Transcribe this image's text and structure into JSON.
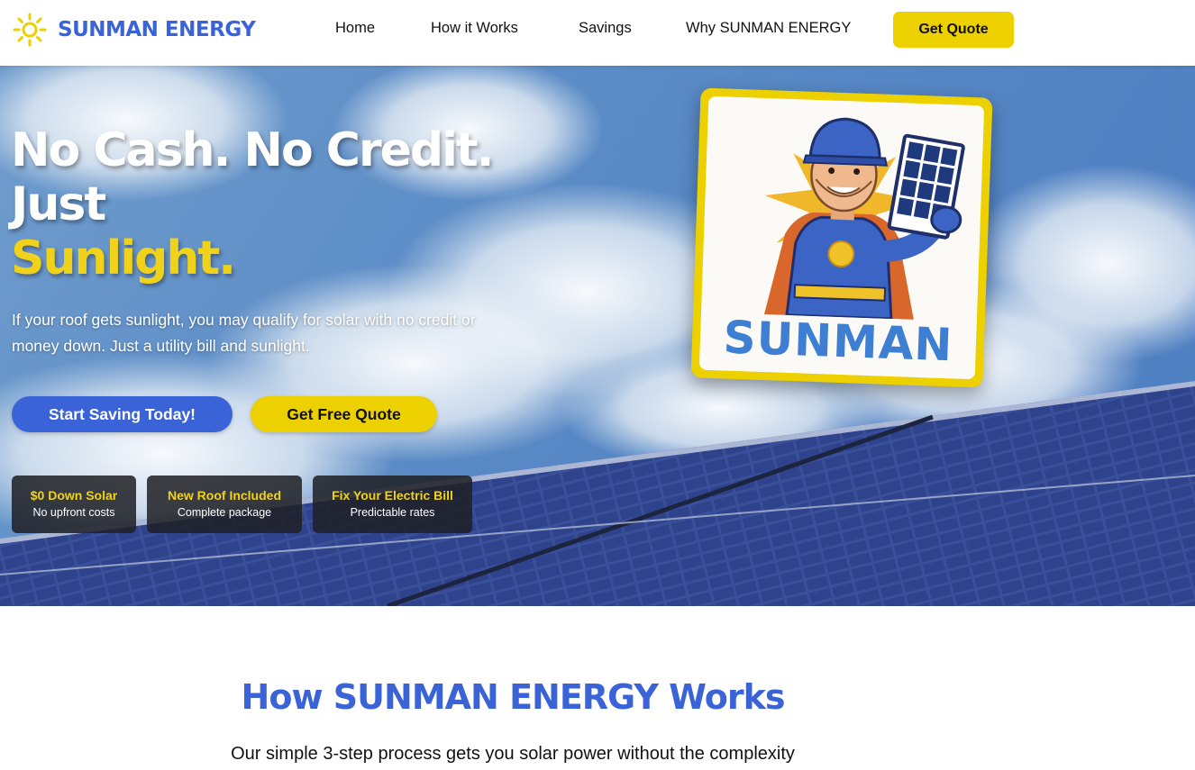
{
  "brand": {
    "name": "SUNMAN ENERGY",
    "accent": "#3a63d8",
    "yellow": "#ecd000"
  },
  "nav": {
    "links": [
      "Home",
      "How it Works",
      "Savings",
      "Why SUNMAN ENERGY"
    ],
    "cta": "Get Quote"
  },
  "hero": {
    "headline_line1": "No Cash. No Credit.",
    "headline_line2": "Just",
    "headline_line3": "Sunlight.",
    "subtitle": "If your roof gets sunlight, you may qualify for solar with no credit or money down. Just a utility bill and sunlight.",
    "primary_button": "Start Saving Today!",
    "secondary_button": "Get Free Quote",
    "features": [
      {
        "title": "$0 Down Solar",
        "subtitle": "No upfront costs"
      },
      {
        "title": "New Roof Included",
        "subtitle": "Complete package"
      },
      {
        "title": "Fix Your Electric Bill",
        "subtitle": "Predictable rates"
      }
    ],
    "mascot_label": "SUNMAN"
  },
  "how_it_works": {
    "title": "How SUNMAN ENERGY Works",
    "subtitle": "Our simple 3-step process gets you solar power without the complexity"
  }
}
